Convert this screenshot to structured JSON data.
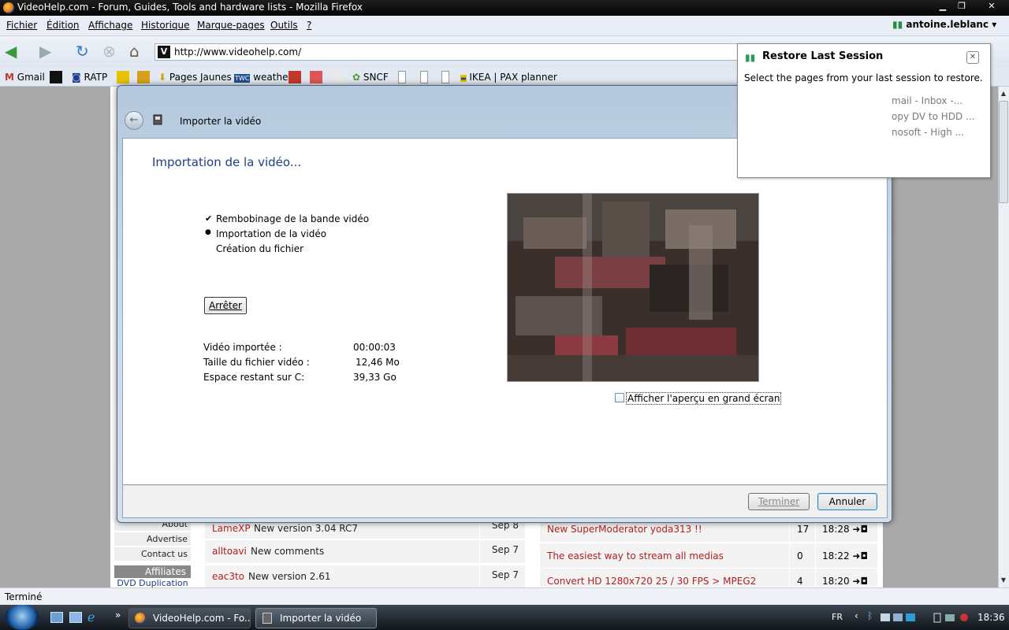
{
  "window": {
    "title": "VideoHelp.com - Forum, Guides, Tools and hardware lists - Mozilla Firefox",
    "min": "▁",
    "max": "❐",
    "close": "✕"
  },
  "menu": [
    "Fichier",
    "Édition",
    "Affichage",
    "Historique",
    "Marque-pages",
    "Outils",
    "?"
  ],
  "nav": {
    "url": "http://www.videohelp.com/",
    "fav": "V"
  },
  "user": "antoine.leblanc",
  "bookmarks": [
    "Gmail",
    "RATP",
    "Pages Jaunes",
    "weather",
    "SNCF",
    "IKEA | PAX planner"
  ],
  "page": {
    "left_menu": [
      "About",
      "Advertise",
      "Contact us"
    ],
    "affiliates": "Affiliates",
    "dvd": "DVD Duplication",
    "news": [
      {
        "a": "LameXP",
        "b": "New version 3.04 RC7",
        "date": "Sep 8"
      },
      {
        "a": "alltoavi",
        "b": "New comments",
        "date": "Sep 7"
      },
      {
        "a": "eac3to",
        "b": "New version 2.61",
        "date": "Sep 7"
      }
    ],
    "forum": [
      {
        "t": "New SuperModerator yoda313 !!",
        "n": "17",
        "tm": "18:28 ➜◘"
      },
      {
        "t": "The easiest way to stream all medias",
        "n": "0",
        "tm": "18:22 ➜◘"
      },
      {
        "t": "Convert HD 1280x720 25 / 30 FPS > MPEG2",
        "n": "4",
        "tm": "18:20 ➜◘"
      }
    ]
  },
  "dialog": {
    "close": "✕",
    "title": "Importer la vidéo",
    "heading": "Importation de la vidéo...",
    "steps": [
      {
        "mark": "✔",
        "label": "Rembobinage de la bande vidéo"
      },
      {
        "mark": "●",
        "label": "Importation de la vidéo"
      },
      {
        "mark": "",
        "label": "Création du fichier"
      }
    ],
    "stop": "Arrêter",
    "stats": [
      {
        "label": "Vidéo importée :",
        "value": "00:00:03"
      },
      {
        "label": "Taille du fichier vidéo :",
        "value": "12,46 Mo"
      },
      {
        "label": "Espace restant sur C:",
        "value": "39,33 Go"
      }
    ],
    "checkbox": "Afficher l'aperçu en grand écran",
    "finish": "Terminer",
    "cancel": "Annuler"
  },
  "restore": {
    "title": "Restore Last Session",
    "desc": "Select the pages from your last session to restore.",
    "items": [
      "mail - Inbox -...",
      "opy DV to HDD ...",
      "nosoft - High ..."
    ],
    "close": "✕"
  },
  "status": "Terminé",
  "taskbar": {
    "items": [
      "VideoHelp.com - Fo...",
      "Importer la vidéo"
    ],
    "lang": "FR",
    "clock": "18:36",
    "more": "»"
  }
}
